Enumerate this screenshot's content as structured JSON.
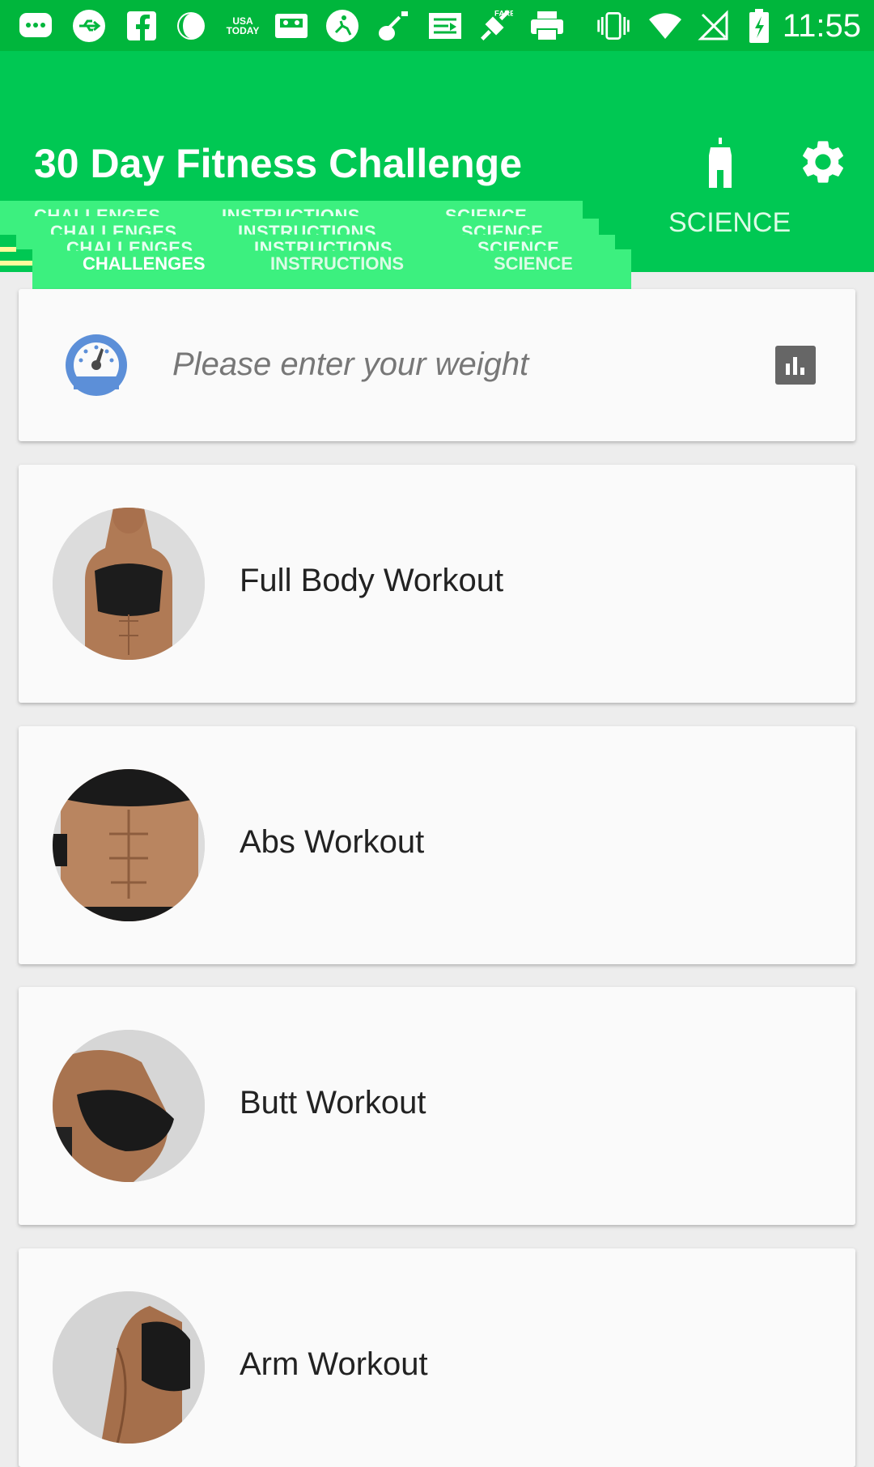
{
  "status_bar": {
    "time": "11:55",
    "icons": [
      "messaging-icon",
      "usb-icon",
      "facebook-icon",
      "night-mode-icon",
      "usa-today-icon",
      "cassette-icon",
      "soccer-icon",
      "guitar-icon",
      "news-icon",
      "fake-gps-icon",
      "printer-icon",
      "vibrate-icon",
      "wifi-icon",
      "no-signal-icon",
      "battery-charging-icon"
    ],
    "usa_today_text": "USA TODAY",
    "fake_text": "FAKE"
  },
  "app_bar": {
    "title": "30 Day Fitness Challenge",
    "background_color": "#00c853",
    "actions": [
      "hanger-icon",
      "settings-icon"
    ]
  },
  "tabs": {
    "items": [
      "CHALLENGES",
      "INSTRUCTIONS",
      "SCIENCE"
    ],
    "right_science_label": "SCIENCE",
    "indicator_color": "#fffa9c"
  },
  "weight_card": {
    "placeholder": "Please enter your weight",
    "left_icon": "speedometer-icon",
    "right_icon": "bar-chart-icon",
    "icon_color": "#5c8fd8"
  },
  "workouts": [
    {
      "label": "Full Body Workout"
    },
    {
      "label": "Abs Workout"
    },
    {
      "label": "Butt Workout"
    },
    {
      "label": "Arm Workout"
    }
  ]
}
